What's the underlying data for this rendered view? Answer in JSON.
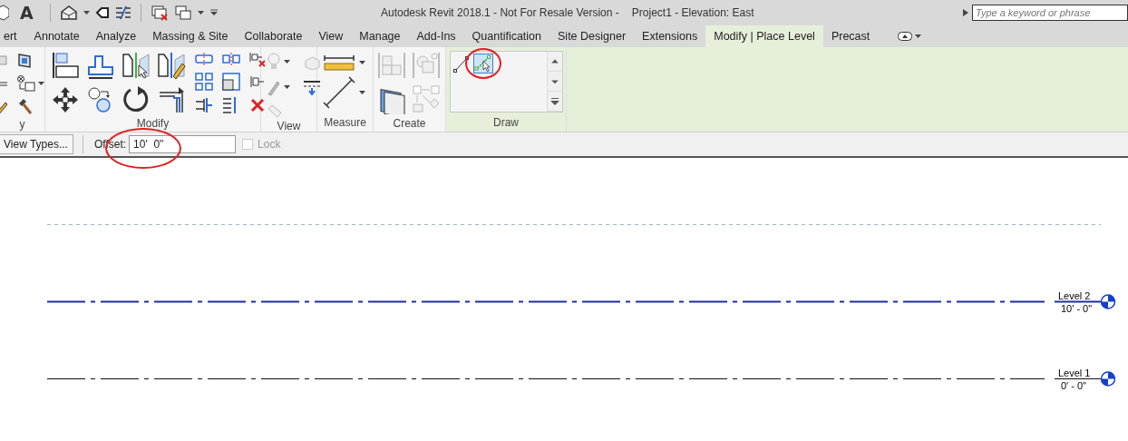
{
  "title_bar": {
    "quick_access_text": "A",
    "title": "Autodesk Revit 2018.1 - Not For Resale Version -",
    "document": "Project1 - Elevation: East",
    "search": {
      "placeholder": "Type a keyword or phrase"
    }
  },
  "tabs": [
    {
      "label": "ert",
      "selected": false
    },
    {
      "label": "Annotate",
      "selected": false
    },
    {
      "label": "Analyze",
      "selected": false
    },
    {
      "label": "Massing & Site",
      "selected": false
    },
    {
      "label": "Collaborate",
      "selected": false
    },
    {
      "label": "View",
      "selected": false
    },
    {
      "label": "Manage",
      "selected": false
    },
    {
      "label": "Add-Ins",
      "selected": false
    },
    {
      "label": "Quantification",
      "selected": false
    },
    {
      "label": "Site Designer",
      "selected": false
    },
    {
      "label": "Extensions",
      "selected": false
    },
    {
      "label": "Modify | Place Level",
      "selected": true
    },
    {
      "label": "Precast",
      "selected": false
    }
  ],
  "ribbon": {
    "panels": [
      {
        "label": "y",
        "kind": "partial",
        "contextual": false
      },
      {
        "label": "Modify",
        "kind": "modify",
        "contextual": false
      },
      {
        "label": "View",
        "kind": "view",
        "contextual": false
      },
      {
        "label": "Measure",
        "kind": "measure",
        "contextual": false
      },
      {
        "label": "Create",
        "kind": "create",
        "contextual": false
      },
      {
        "label": "Draw",
        "kind": "draw",
        "contextual": true
      }
    ]
  },
  "draw_tools": [
    {
      "kind": "line",
      "selected": false
    },
    {
      "kind": "pick",
      "selected": true
    }
  ],
  "options_bar": {
    "button": "View Types...",
    "offset_label": "Offset:",
    "offset_value": "10'  0\"",
    "lock": {
      "label": "Lock",
      "checked": false,
      "disabled": true
    }
  },
  "levels": [
    {
      "name": "Level 2",
      "elevation": "10' - 0\"",
      "selected": true
    },
    {
      "name": "Level 1",
      "elevation": "0' - 0\"",
      "selected": false
    }
  ]
}
